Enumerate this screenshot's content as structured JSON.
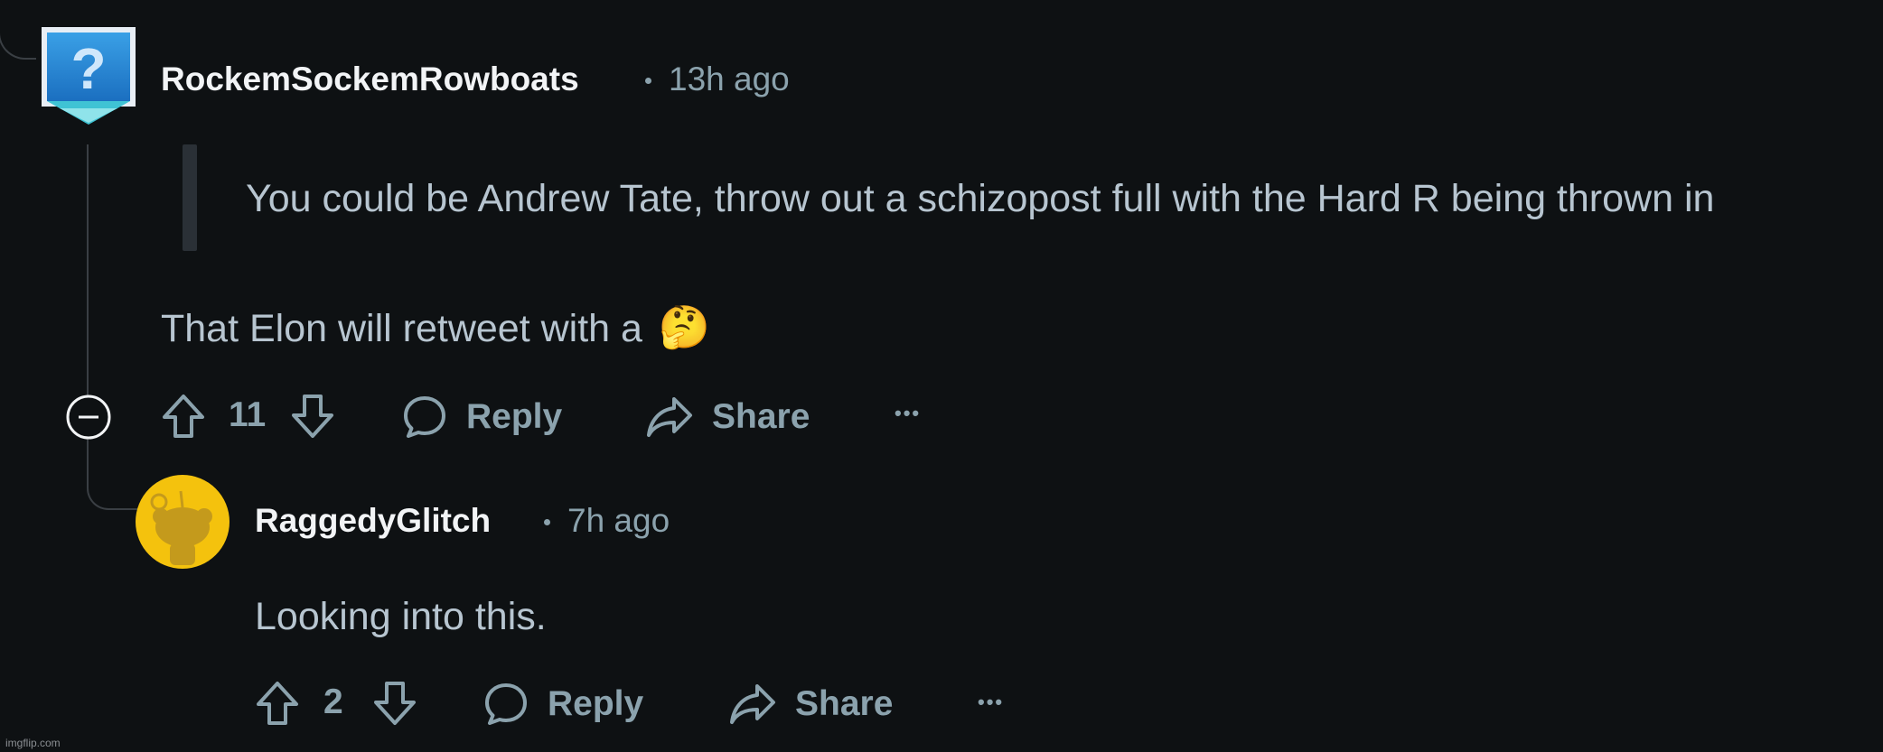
{
  "comment1": {
    "username": "RockemSockemRowboats",
    "time": "13h ago",
    "quote": "You could be Andrew Tate, throw out a schizopost full with the Hard R being thrown in",
    "text": "That Elon will retweet with a",
    "emoji": "🤔",
    "votes": "11",
    "reply_label": "Reply",
    "share_label": "Share",
    "more_label": "•••"
  },
  "comment2": {
    "username": "RaggedyGlitch",
    "time": "7h ago",
    "text": "Looking into this.",
    "votes": "2",
    "reply_label": "Reply",
    "share_label": "Share",
    "more_label": "•••"
  },
  "watermark": "imgflip.com",
  "colors": {
    "background": "#0e1113",
    "text": "#b7c5d0",
    "muted": "#8ba2ad",
    "username": "#f2f4f6",
    "snoo_avatar": "#f4c20d"
  }
}
